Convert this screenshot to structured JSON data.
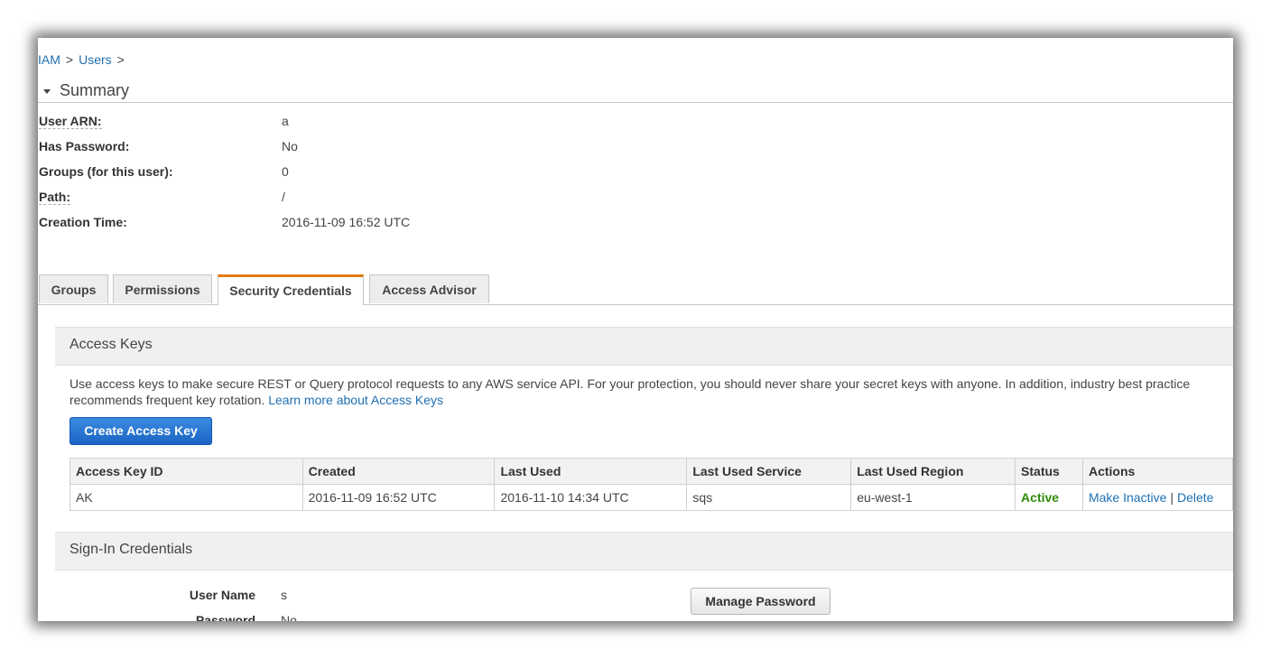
{
  "breadcrumb": {
    "iam": "IAM",
    "users": "Users",
    "sep": ">"
  },
  "summary": {
    "title": "Summary",
    "rows": [
      {
        "label": "User ARN:",
        "value": "a"
      },
      {
        "label": "Has Password:",
        "value": "No"
      },
      {
        "label": "Groups (for this user):",
        "value": "0"
      },
      {
        "label": "Path:",
        "value": "/"
      },
      {
        "label": "Creation Time:",
        "value": "2016-11-09 16:52 UTC"
      }
    ]
  },
  "tabs": [
    {
      "label": "Groups"
    },
    {
      "label": "Permissions"
    },
    {
      "label": "Security Credentials",
      "active": true
    },
    {
      "label": "Access Advisor"
    }
  ],
  "access_keys": {
    "title": "Access Keys",
    "description": "Use access keys to make secure REST or Query protocol requests to any AWS service API. For your protection, you should never share your secret keys with anyone. In addition, industry best practice recommends frequent key rotation.",
    "learn_more": "Learn more about Access Keys",
    "create_button": "Create Access Key",
    "columns": [
      "Access Key ID",
      "Created",
      "Last Used",
      "Last Used Service",
      "Last Used Region",
      "Status",
      "Actions"
    ],
    "rows": [
      {
        "id": "AK",
        "created": "2016-11-09 16:52 UTC",
        "last_used": "2016-11-10 14:34 UTC",
        "service": "sqs",
        "region": "eu-west-1",
        "status": "Active",
        "action_inactive": "Make Inactive",
        "action_sep": "|",
        "action_delete": "Delete"
      }
    ]
  },
  "sign_in": {
    "title": "Sign-In Credentials",
    "user_name_label": "User Name",
    "user_name_value": "s",
    "password_label": "Password",
    "password_value": "No",
    "manage_button": "Manage Password"
  },
  "colors": {
    "link": "#1f6fb2",
    "active_tab": "#e47911",
    "status_active": "#2e8b09",
    "primary_button": "#1b64c4"
  }
}
